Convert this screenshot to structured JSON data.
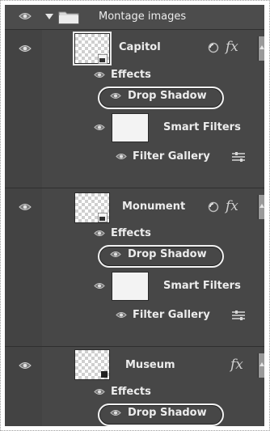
{
  "group": {
    "label": "Montage images"
  },
  "layers": [
    {
      "name": "Capitol",
      "effects_label": "Effects",
      "effect": "Drop Shadow",
      "smart_filters_label": "Smart Filters",
      "filter": "Filter Gallery",
      "has_mask_link": true,
      "has_fx": true
    },
    {
      "name": "Monument",
      "effects_label": "Effects",
      "effect": "Drop Shadow",
      "smart_filters_label": "Smart Filters",
      "filter": "Filter Gallery",
      "has_mask_link": true,
      "has_fx": true
    },
    {
      "name": "Museum",
      "effects_label": "Effects",
      "effect": "Drop Shadow",
      "has_fx": true
    }
  ],
  "fx_symbol": "fx"
}
